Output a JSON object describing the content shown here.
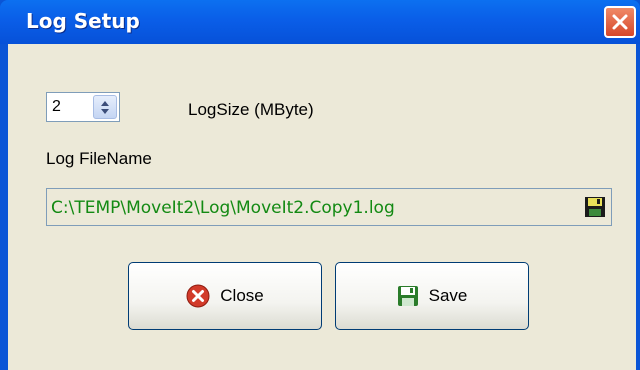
{
  "window": {
    "title": "Log Setup",
    "close_icon": "close-x-icon"
  },
  "log_size": {
    "value": "2",
    "label": "LogSize (MByte)"
  },
  "log_file": {
    "label": "Log FileName",
    "path": "C:\\TEMP\\MoveIt2\\Log\\MoveIt2.Copy1.log",
    "browse_icon": "floppy-disk-icon"
  },
  "buttons": {
    "close_label": "Close",
    "close_icon": "red-x-circle-icon",
    "save_label": "Save",
    "save_icon": "floppy-disk-icon"
  },
  "colors": {
    "titlebar": "#0a5ee8",
    "path_text": "#138a13",
    "dialog_bg": "#ece9d8"
  }
}
